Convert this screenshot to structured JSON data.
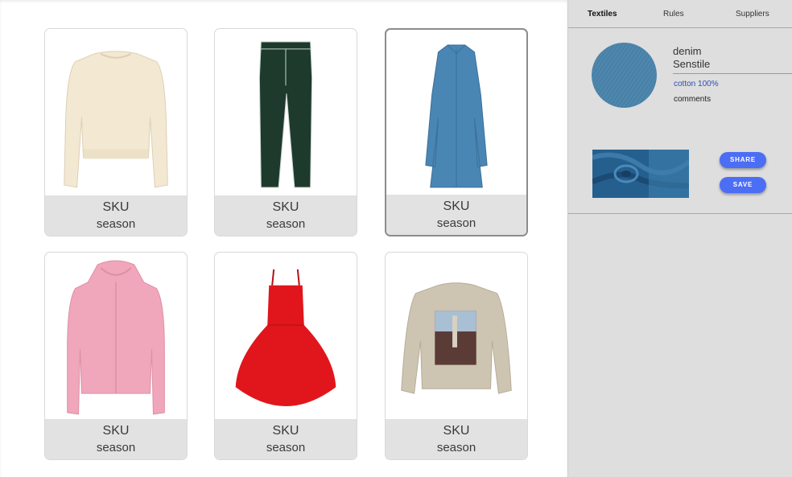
{
  "products": [
    {
      "sku": "SKU",
      "season": "season",
      "item": "cream-sweatshirt",
      "color": "#f3e8d2"
    },
    {
      "sku": "SKU",
      "season": "season",
      "item": "green-jeans",
      "color": "#1d3a2c"
    },
    {
      "sku": "SKU",
      "season": "season",
      "item": "denim-shirt-dress",
      "color": "#4a86b4",
      "selected": true
    },
    {
      "sku": "SKU",
      "season": "season",
      "item": "pink-zip-hoodie",
      "color": "#f0a6bb"
    },
    {
      "sku": "SKU",
      "season": "season",
      "item": "red-dress",
      "color": "#e0161c"
    },
    {
      "sku": "SKU",
      "season": "season",
      "item": "beige-photo-sweatshirt",
      "color": "#cdc4b2"
    }
  ],
  "panel": {
    "tabs": [
      {
        "label": "Textiles",
        "active": true
      },
      {
        "label": "Rules",
        "active": false
      },
      {
        "label": "Suppliers",
        "active": false
      }
    ],
    "fabric": {
      "name": "denim",
      "brand": "Senstile",
      "composition": "cotton 100%",
      "comments": "comments",
      "color": "#4e87ad"
    },
    "share_label": "SHARE",
    "save_label": "SAVE",
    "accent": "#4c6ef5"
  }
}
